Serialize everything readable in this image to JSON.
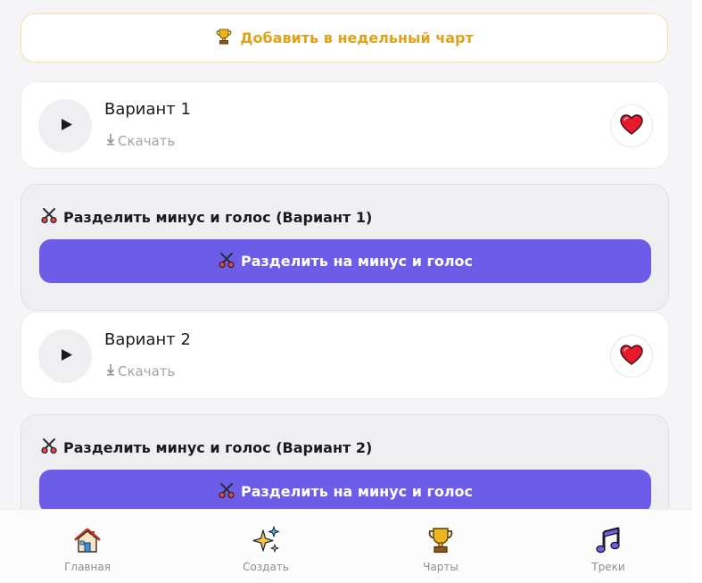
{
  "chart_button": {
    "label": "Добавить в недельный чарт",
    "icon": "trophy-icon"
  },
  "tracks": [
    {
      "title": "Вариант 1",
      "download_label": "Скачать",
      "favorite_icon": "heart-icon",
      "split": {
        "heading": "Разделить минус и голос (Вариант 1)",
        "button_label": "Разделить на минус и голос"
      }
    },
    {
      "title": "Вариант 2",
      "download_label": "Скачать",
      "favorite_icon": "heart-icon",
      "split": {
        "heading": "Разделить минус и голос (Вариант 2)",
        "button_label": "Разделить на минус и голос"
      }
    }
  ],
  "bottom_nav": [
    {
      "label": "Главная",
      "icon": "house-icon"
    },
    {
      "label": "Создать",
      "icon": "sparkles-icon"
    },
    {
      "label": "Чарты",
      "icon": "trophy-icon"
    },
    {
      "label": "Треки",
      "icon": "music-notes-icon"
    }
  ],
  "colors": {
    "accent": "#6c5ce7",
    "chart_gold": "#e0a21a",
    "heart": "#e8192c"
  }
}
